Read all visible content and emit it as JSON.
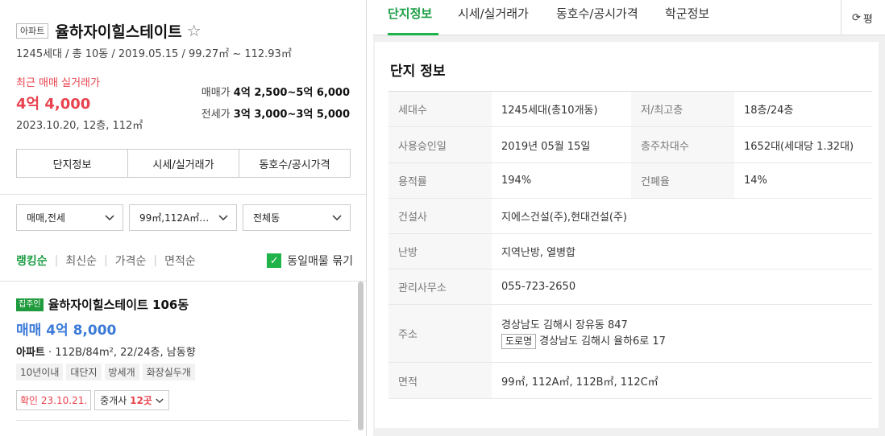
{
  "complex": {
    "type_badge": "아파트",
    "name": "율하자이힐스테이트",
    "star": "☆",
    "summary": "1245세대 / 총 10동 / 2019.05.15 / 99.27㎡ ~ 112.93㎡",
    "recent_label": "최근 매매 실거래가",
    "recent_price": "4억 4,000",
    "recent_date": "2023.10.20, 12층, 112㎡",
    "sale_range_label": "매매가",
    "sale_range_value": "4억 2,500~5억 6,000",
    "jeonse_range_label": "전세가",
    "jeonse_range_value": "3억 3,000~3억 5,000"
  },
  "left_buttons": [
    "단지정보",
    "시세/실거래가",
    "동호수/공시가격"
  ],
  "filters": [
    {
      "label": "매매,전세",
      "icon": "chevron-down-icon"
    },
    {
      "label": "99㎡,112A㎡…",
      "icon": "chevron-down-icon"
    },
    {
      "label": "전체동",
      "icon": "chevron-down-icon"
    }
  ],
  "sort": {
    "options": [
      "랭킹순",
      "최신순",
      "가격순",
      "면적순"
    ],
    "active": "랭킹순",
    "bundle_label": "동일매물 묶기",
    "bundle_checked": true
  },
  "listing": {
    "badge": "집주인",
    "title": "율하자이힐스테이트 106동",
    "price": "매매 4억 8,000",
    "desc_type": "아파트",
    "desc_rest": " · 112B/84m², 22/24층, 남동향",
    "tags": [
      "10년이내",
      "대단지",
      "방세개",
      "화장실두개"
    ],
    "confirm": "확인 23.10.21.",
    "agents_label": "중개사",
    "agents_count": "12곳"
  },
  "right_tabs": [
    "단지정보",
    "시세/실거래가",
    "동호수/공시가격",
    "학군정보"
  ],
  "active_tab": "단지정보",
  "refresh_label": "평",
  "info": {
    "title": "단지 정보",
    "rows": [
      {
        "k1": "세대수",
        "v1": "1245세대(총10개동)",
        "k2": "저/최고층",
        "v2": "18층/24층"
      },
      {
        "k1": "사용승인일",
        "v1": "2019년 05월 15일",
        "k2": "총주차대수",
        "v2": "1652대(세대당 1.32대)"
      },
      {
        "k1": "용적률",
        "v1": "194%",
        "k2": "건폐율",
        "v2": "14%"
      }
    ],
    "builder_label": "건설사",
    "builder": "지에스건설(주),현대건설(주)",
    "heating_label": "난방",
    "heating": "지역난방, 열병합",
    "office_label": "관리사무소",
    "office": "055-723-2650",
    "address_label": "주소",
    "address": "경상남도 김해시 장유동 847",
    "road_badge": "도로명",
    "road_address": "경상남도 김해시 율하6로 17",
    "area_label": "면적",
    "area": "99㎡, 112A㎡, 112B㎡, 112C㎡"
  }
}
